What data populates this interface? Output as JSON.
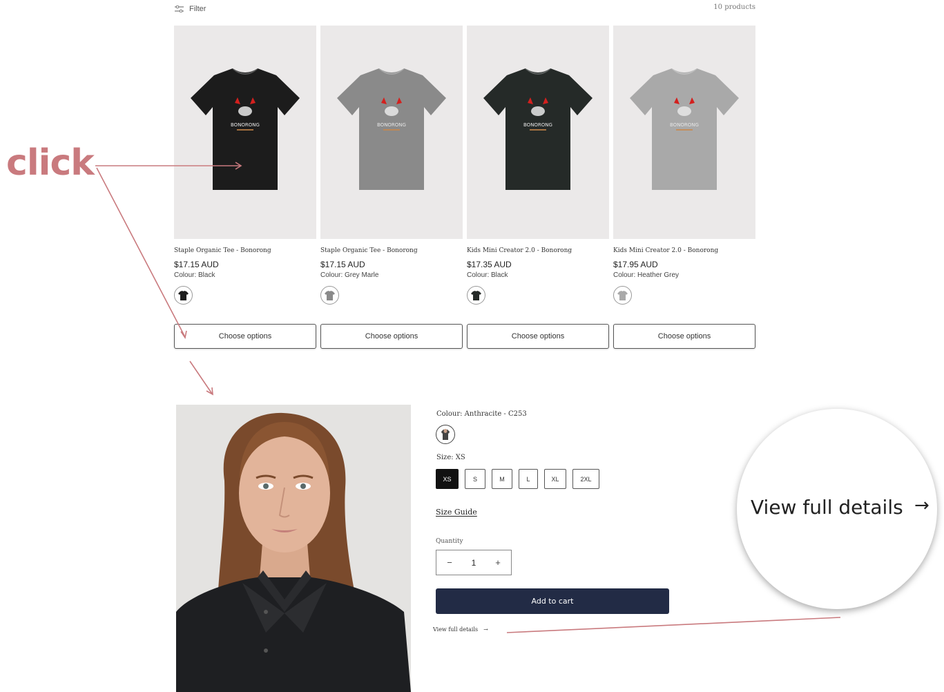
{
  "listing": {
    "filter_label": "Filter",
    "filter_icon": "sliders-icon",
    "product_count": "10 products",
    "products": [
      {
        "name": "Staple Organic Tee - Bonorong",
        "price": "$17.15 AUD",
        "colour": "Colour: Black",
        "shirt_color": "#1c1c1c",
        "button": "Choose options"
      },
      {
        "name": "Staple Organic Tee - Bonorong",
        "price": "$17.15 AUD",
        "colour": "Colour: Grey Marle",
        "shirt_color": "#8a8a8a",
        "button": "Choose options"
      },
      {
        "name": "Kids Mini Creator 2.0 - Bonorong",
        "price": "$17.35 AUD",
        "colour": "Colour: Black",
        "shirt_color": "#252a28",
        "button": "Choose options"
      },
      {
        "name": "Kids Mini Creator 2.0 - Bonorong",
        "price": "$17.95 AUD",
        "colour": "Colour: Heather Grey",
        "shirt_color": "#a9a9a9",
        "button": "Choose options"
      }
    ],
    "shirt_print": "BONORONG"
  },
  "annotation": {
    "click_label": "click",
    "color": "#c97a7e"
  },
  "quick_view": {
    "colour_label": "Colour: Anthracite - C253",
    "size_label": "Size: XS",
    "sizes": [
      "XS",
      "S",
      "M",
      "L",
      "XL",
      "2XL"
    ],
    "selected_size": "XS",
    "size_guide": "Size Guide",
    "quantity_label": "Quantity",
    "quantity_value": "1",
    "minus": "−",
    "plus": "+",
    "add_to_cart": "Add to cart",
    "add_to_cart_color": "#222b45",
    "view_full_details": "View full details",
    "arrow": "→"
  },
  "magnifier": {
    "text": "View full details",
    "arrow": "→"
  }
}
